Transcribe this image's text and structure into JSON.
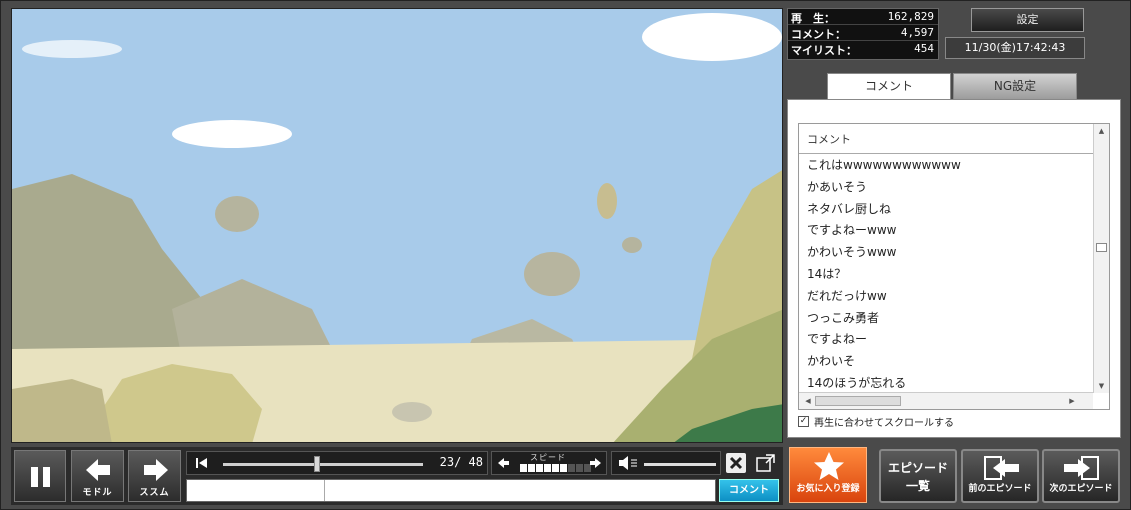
{
  "stats": {
    "views_label": "再　生：",
    "views_value": "162,829",
    "comments_label": "コメント：",
    "comments_value": "4,597",
    "mylist_label": "マイリスト：",
    "mylist_value": "454"
  },
  "settings_label": "設定",
  "clock": "11/30(金)17:42:43",
  "tabs": {
    "comment": "コメント",
    "ng": "NG設定"
  },
  "comment_list": {
    "header": "コメント",
    "rows": [
      "これはwwwwwwwwwwww",
      "かあいそう",
      "ネタバレ厨しね",
      "ですよねーwww",
      "かわいそうwww",
      "14は？",
      "だれだっけww",
      "つっこみ勇者",
      "ですよねー",
      "かわいそ",
      "14のほうが忘れる"
    ]
  },
  "autoscroll_label": "再生に合わせてスクロールする",
  "autoscroll_checked": true,
  "player": {
    "back_label": "モドル",
    "forward_label": "ススム",
    "page": "23/ 48",
    "seek_fraction": 0.47,
    "speed_label": "スピード",
    "speed_level": 6,
    "speed_max": 9,
    "comment_button": "コメント"
  },
  "buttons": {
    "favorite": "お気に入り登録",
    "episode_list_line1": "エピソード",
    "episode_list_line2": "一覧",
    "prev_episode": "前のエピソード",
    "next_episode": "次のエピソード"
  },
  "colors": {
    "accent_orange": "#e85a16",
    "comment_blue": "#1aa8dc",
    "sky": "#a9cbe9"
  }
}
